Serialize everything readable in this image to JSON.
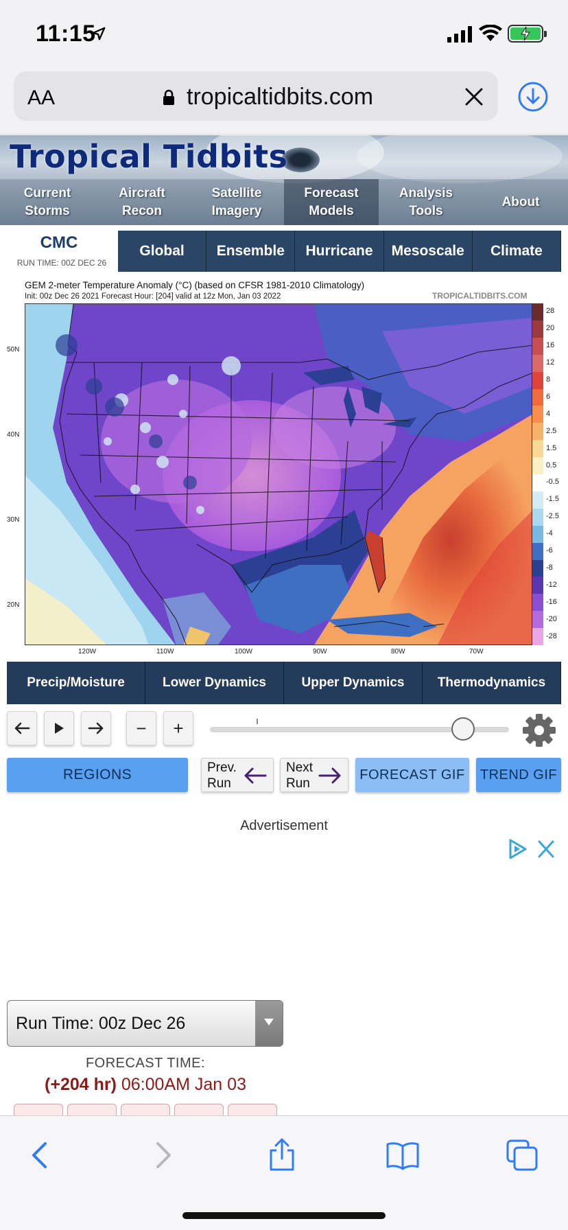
{
  "status_bar": {
    "time": "11:15"
  },
  "browser": {
    "text_size_label": "AA",
    "url": "tropicaltidbits.com"
  },
  "site": {
    "logo_text": "Tropical Tidbits",
    "nav": [
      {
        "line1": "Current",
        "line2": "Storms"
      },
      {
        "line1": "Aircraft",
        "line2": "Recon"
      },
      {
        "line1": "Satellite",
        "line2": "Imagery"
      },
      {
        "line1": "Forecast",
        "line2": "Models"
      },
      {
        "line1": "Analysis",
        "line2": "Tools"
      },
      {
        "line1": "About",
        "line2": ""
      }
    ]
  },
  "model": {
    "name": "CMC",
    "run_time": "RUN TIME: 00Z DEC 26",
    "tabs": [
      "Global",
      "Ensemble",
      "Hurricane",
      "Mesoscale",
      "Climate"
    ]
  },
  "map": {
    "title": "GEM 2-meter Temperature Anomaly (°C) (based on CFSR 1981-2010 Climatology)",
    "subtitle": "Init: 00z Dec 26 2021   Forecast Hour: [204]   valid at 12z Mon, Jan 03 2022",
    "brand": "TROPICALTIDBITS.COM",
    "lat_labels": [
      "50N",
      "40N",
      "30N",
      "20N"
    ],
    "lon_labels": [
      "120W",
      "110W",
      "100W",
      "90W",
      "80W",
      "70W"
    ],
    "colorbar_labels": [
      "28",
      "20",
      "16",
      "12",
      "8",
      "6",
      "4",
      "2.5",
      "1.5",
      "0.5",
      "-0.5",
      "-1.5",
      "-2.5",
      "-4",
      "-6",
      "-8",
      "-12",
      "-16",
      "-20",
      "-28"
    ],
    "colorbar_colors": [
      "#6b2b2b",
      "#9c3b3b",
      "#c45050",
      "#d86a6a",
      "#e0433a",
      "#f06a3a",
      "#f58e4a",
      "#f7b269",
      "#f9d894",
      "#fbf0c4",
      "#ffffff",
      "#d3ebf5",
      "#a9d8ef",
      "#76b9e6",
      "#3f6fc2",
      "#2b3f93",
      "#5a37b0",
      "#8a4fd1",
      "#b46be0",
      "#e9a8e5"
    ]
  },
  "categories": [
    "Precip/Moisture",
    "Lower Dynamics",
    "Upper Dynamics",
    "Thermodynamics"
  ],
  "controls": {
    "prev_icon": "arrow-left-icon",
    "play_icon": "play-icon",
    "next_icon": "arrow-right-icon",
    "minus_label": "−",
    "plus_label": "+",
    "settings_icon": "gear-icon"
  },
  "actions": {
    "regions": "REGIONS",
    "prev_run_1": "Prev.",
    "prev_run_2": "Run",
    "next_run_1": "Next",
    "next_run_2": "Run",
    "forecast_gif": "FORECAST GIF",
    "trend_gif": "TREND GIF"
  },
  "ad": {
    "label": "Advertisement"
  },
  "run_select": {
    "value": "Run Time: 00z Dec 26"
  },
  "forecast_time": {
    "label": "FORECAST TIME:",
    "hours": "(+204 hr)",
    "datetime": " 06:00AM Jan 03"
  },
  "colors": {
    "nav_dark": "#27415f",
    "button_blue": "#5aa0f0",
    "forecast_red": "#8b1a1a",
    "ios_blue": "#2f7cf6"
  }
}
